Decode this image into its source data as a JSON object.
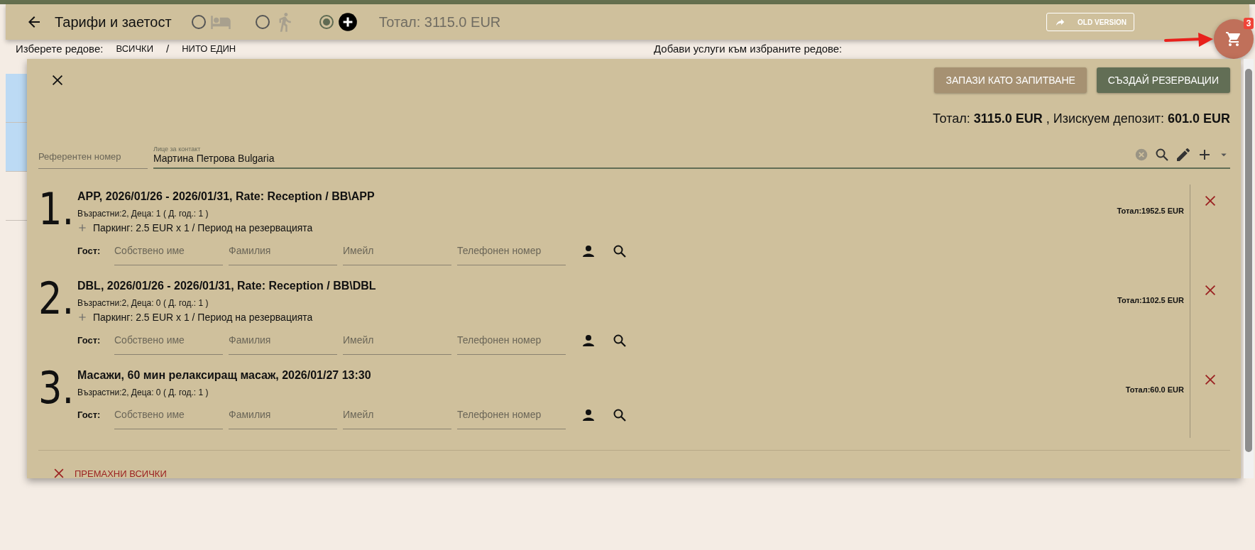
{
  "header": {
    "title": "Тарифи и заетост",
    "modes": [
      {
        "kind": "bed",
        "selected": false
      },
      {
        "kind": "walk",
        "selected": false
      },
      {
        "kind": "extra",
        "selected": true
      }
    ],
    "total": "Тотал: 3115.0 EUR",
    "old_version_button": "OLD VERSION"
  },
  "cart": {
    "count": "3"
  },
  "background": {
    "select_label": "Изберете редове:",
    "select_all": "ВСИЧКИ",
    "separator": "/",
    "select_none": "НИТО ЕДИН",
    "add_services_label": "Добави услуги към избраните редове:",
    "rows": [
      {
        "selected": true
      },
      {
        "selected": true
      },
      {
        "selected": false
      }
    ]
  },
  "dialog": {
    "buttons": [
      {
        "label": "ЗАПАЗИ КАТО ЗАПИТВАНЕ",
        "kind": "secondary"
      },
      {
        "label": "СЪЗДАЙ РЕЗЕРВАЦИИ",
        "kind": "primary"
      }
    ],
    "summary": "Тотал: **3115.0 EUR** , Изискуем депозит: **601.0 EUR**",
    "reference": {
      "placeholder": "Референтен номер"
    },
    "contact": {
      "label": "Лице за контакт",
      "value": "Мартина Петрова Bulgaria"
    },
    "items": [
      {
        "number": "1.",
        "title": "APP, 2026/01/26 - 2026/01/31, Rate: Reception / BB\\APP",
        "guests": "Възрастни:2, Деца: 1 ( Д. год.: 1 )",
        "extras": [
          "Паркинг: 2.5 EUR x 1 / Период на резервацията"
        ],
        "total": "Тотал:1952.5 EUR",
        "guest_label": "Гост:",
        "placeholders": [
          "Собствено име",
          "Фамилия",
          "Имейл",
          "Телефонен номер"
        ]
      },
      {
        "number": "2.",
        "title": "DBL, 2026/01/26 - 2026/01/31, Rate: Reception / BB\\DBL",
        "guests": "Възрастни:2, Деца: 0 ( Д. год.: 1 )",
        "extras": [
          "Паркинг: 2.5 EUR x 1 / Период на резервацията"
        ],
        "total": "Тотал:1102.5 EUR",
        "guest_label": "Гост:",
        "placeholders": [
          "Собствено име",
          "Фамилия",
          "Имейл",
          "Телефонен номер"
        ]
      },
      {
        "number": "3.",
        "title": "Масажи, 60 мин релаксиращ масаж, 2026/01/27 13:30",
        "guests": "Възрастни:2, Деца: 0 ( Д. год.: 1 )",
        "total": "Тотал:60.0 EUR",
        "guest_label": "Гост:",
        "placeholders": [
          "Собствено име",
          "Фамилия",
          "Имейл",
          "Телефонен номер"
        ]
      }
    ],
    "remove_all": "ПРЕМАХНИ ВСИЧКИ"
  }
}
